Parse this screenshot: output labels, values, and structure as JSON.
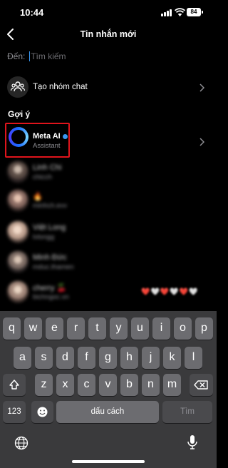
{
  "status_bar": {
    "time": "10:44",
    "battery": "84"
  },
  "header": {
    "title": "Tin nhắn mới"
  },
  "to_field": {
    "label": "Đến:",
    "placeholder": "Tìm kiếm"
  },
  "create_group": {
    "label": "Tạo nhóm chat"
  },
  "suggestions": {
    "title": "Gợi ý",
    "contacts": [
      {
        "name": "Meta AI",
        "subtitle": "Assistant",
        "verified": true
      },
      {
        "name": "Linh Chi",
        "subtitle": "chicch"
      },
      {
        "name": "🔥",
        "subtitle": "minhch.evv"
      },
      {
        "name": "Việt Long",
        "subtitle": "lvlongg"
      },
      {
        "name": "Minh Đức",
        "subtitle": "mduc.thamen"
      },
      {
        "name": "cherry 🍒",
        "subtitle": "bichngoc.vn",
        "extra": "❤️🤍❤️🤍❤️🤍"
      }
    ]
  },
  "keyboard": {
    "row1": [
      "q",
      "w",
      "e",
      "r",
      "t",
      "y",
      "u",
      "i",
      "o",
      "p"
    ],
    "row2": [
      "a",
      "s",
      "d",
      "f",
      "g",
      "h",
      "j",
      "k",
      "l"
    ],
    "row3": [
      "z",
      "x",
      "c",
      "v",
      "b",
      "n",
      "m"
    ],
    "numbers_key": "123",
    "space_key": "dấu cách",
    "search_key": "Tìm"
  },
  "colors": {
    "accent": "#3897f0",
    "highlight": "#e0141c",
    "key": "#6c6c70",
    "keyboard_bg": "#3a3a3c"
  }
}
